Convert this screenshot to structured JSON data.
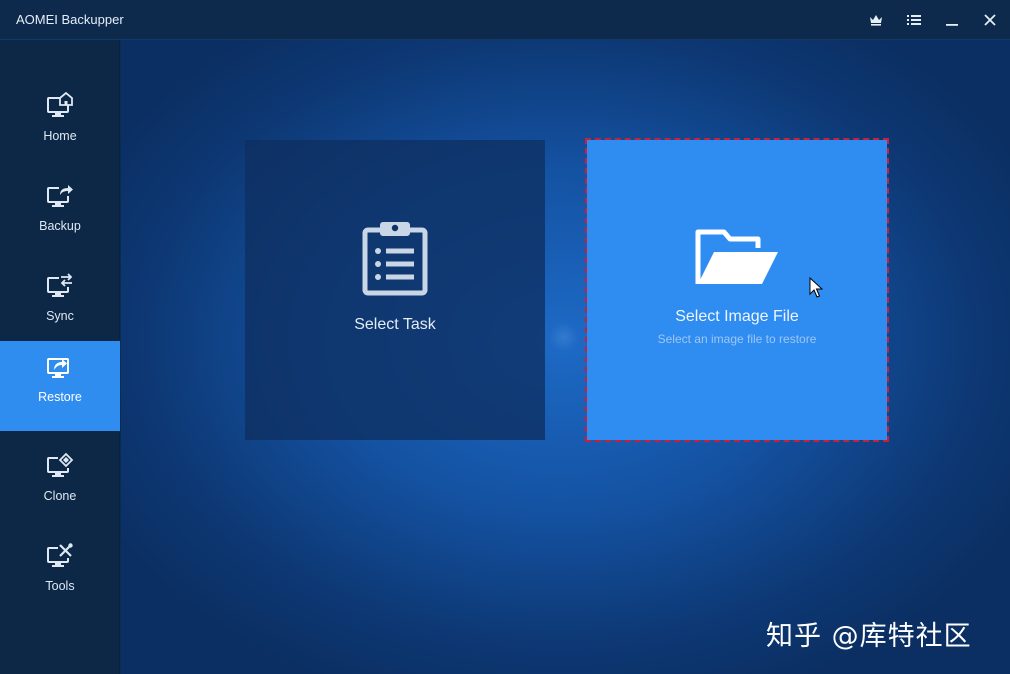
{
  "window": {
    "title": "AOMEI Backupper",
    "controls": [
      "crown-icon",
      "menu-icon",
      "minimize-icon",
      "close-icon"
    ]
  },
  "sidebar": {
    "items": [
      {
        "label": "Home",
        "icon": "home-monitor-icon",
        "active": false
      },
      {
        "label": "Backup",
        "icon": "backup-monitor-icon",
        "active": false
      },
      {
        "label": "Sync",
        "icon": "sync-monitor-icon",
        "active": false
      },
      {
        "label": "Restore",
        "icon": "restore-monitor-icon",
        "active": true
      },
      {
        "label": "Clone",
        "icon": "clone-monitor-icon",
        "active": false
      },
      {
        "label": "Tools",
        "icon": "tools-monitor-icon",
        "active": false
      }
    ]
  },
  "main": {
    "cards": [
      {
        "title": "Select Task",
        "icon": "clipboard-list-icon"
      },
      {
        "title": "Select Image File",
        "subtitle": "Select an image file to restore",
        "icon": "open-folder-icon"
      }
    ]
  },
  "watermark": {
    "text": "知乎 @库特社区"
  },
  "colors": {
    "accent": "#2f8df0",
    "sidebar_bg": "#0c2846",
    "highlight_border": "#c8203a"
  }
}
